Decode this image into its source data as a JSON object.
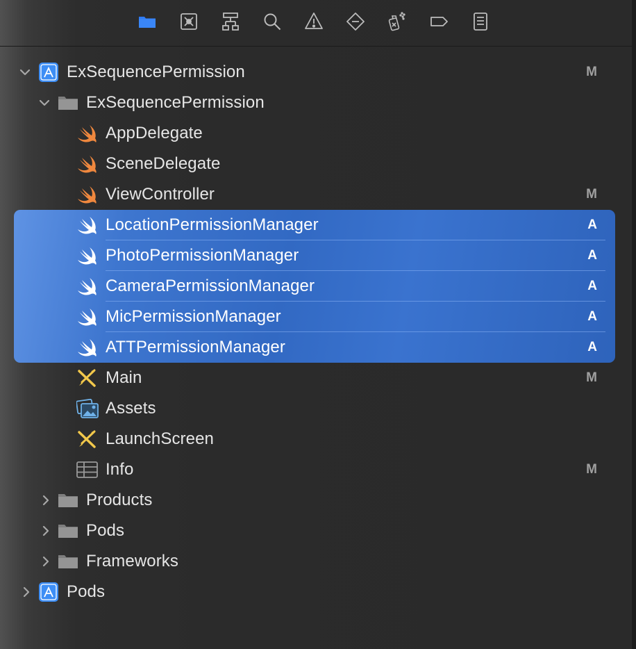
{
  "toolbar": {
    "buttons": [
      {
        "icon": "folder-icon",
        "active": true
      },
      {
        "icon": "source-control-icon",
        "active": false
      },
      {
        "icon": "hierarchy-icon",
        "active": false
      },
      {
        "icon": "search-icon",
        "active": false
      },
      {
        "icon": "warning-icon",
        "active": false
      },
      {
        "icon": "test-diamond-icon",
        "active": false
      },
      {
        "icon": "debug-spray-icon",
        "active": false
      },
      {
        "icon": "breakpoint-tag-icon",
        "active": false
      },
      {
        "icon": "report-list-icon",
        "active": false
      }
    ],
    "accent_color": "#2f7bf5"
  },
  "navigator": {
    "items": [
      {
        "label": "ExSequencePermission",
        "icon": "app-project-icon",
        "status": "M",
        "expanded": true
      },
      {
        "label": "ExSequencePermission",
        "icon": "folder-icon",
        "status": "",
        "expanded": true
      },
      {
        "label": "AppDelegate",
        "icon": "swift-icon",
        "status": ""
      },
      {
        "label": "SceneDelegate",
        "icon": "swift-icon",
        "status": ""
      },
      {
        "label": "ViewController",
        "icon": "swift-icon",
        "status": "M"
      },
      {
        "label": "LocationPermissionManager",
        "icon": "swift-icon",
        "status": "A",
        "selected": true
      },
      {
        "label": "PhotoPermissionManager",
        "icon": "swift-icon",
        "status": "A",
        "selected": true
      },
      {
        "label": "CameraPermissionManager",
        "icon": "swift-icon",
        "status": "A",
        "selected": true
      },
      {
        "label": "MicPermissionManager",
        "icon": "swift-icon",
        "status": "A",
        "selected": true
      },
      {
        "label": "ATTPermissionManager",
        "icon": "swift-icon",
        "status": "A",
        "selected": true
      },
      {
        "label": "Main",
        "icon": "storyboard-icon",
        "status": "M"
      },
      {
        "label": "Assets",
        "icon": "asset-catalog-icon",
        "status": ""
      },
      {
        "label": "LaunchScreen",
        "icon": "storyboard-icon",
        "status": ""
      },
      {
        "label": "Info",
        "icon": "plist-table-icon",
        "status": "M"
      },
      {
        "label": "Products",
        "icon": "folder-icon",
        "status": "",
        "expanded": false
      },
      {
        "label": "Pods",
        "icon": "folder-icon",
        "status": "",
        "expanded": false
      },
      {
        "label": "Frameworks",
        "icon": "folder-icon",
        "status": "",
        "expanded": false
      },
      {
        "label": "Pods",
        "icon": "app-project-icon",
        "status": "",
        "expanded": false
      }
    ],
    "colors": {
      "selection": "#3a6fc8",
      "swift_orange": "#f0883e",
      "text": "#e6e6e6",
      "status": "#a0a0a0"
    }
  }
}
